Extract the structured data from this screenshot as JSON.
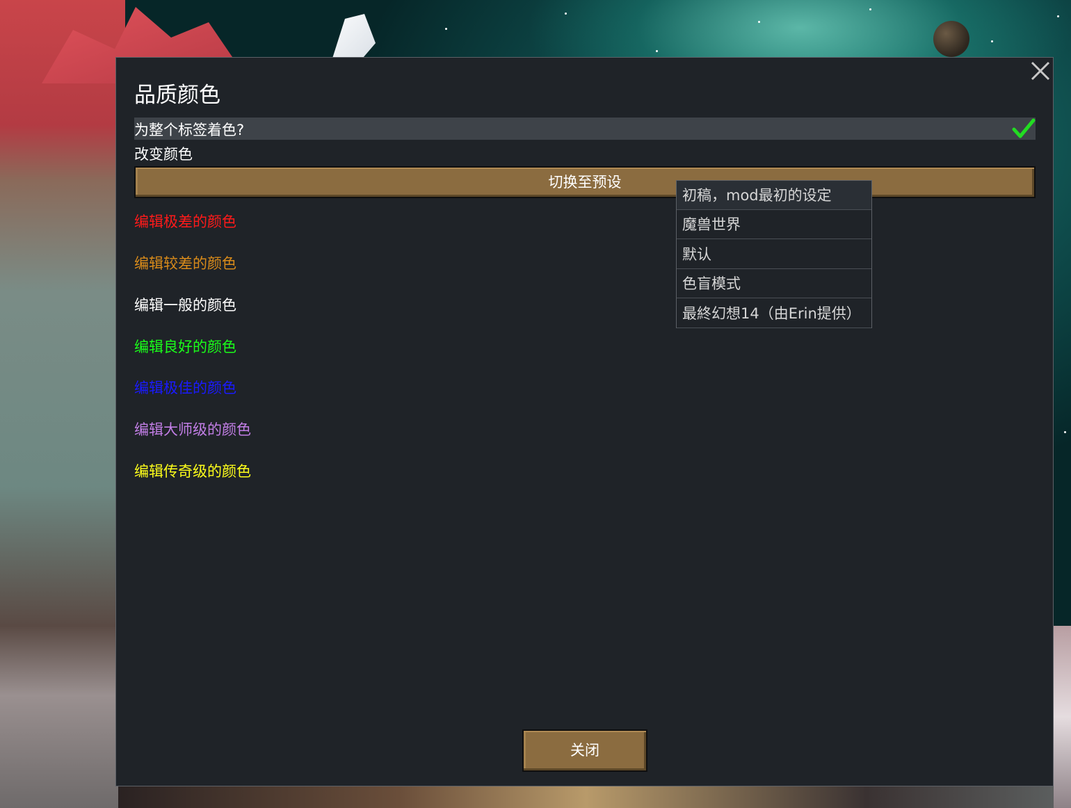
{
  "dialog": {
    "title": "品质颜色",
    "colorize_whole_label": "为整个标签着色?",
    "colorize_whole_checked": true,
    "change_color_label": "改变颜色",
    "preset_button_label": "切换至预设",
    "close_button_label": "关闭"
  },
  "quality_items": [
    {
      "label": "编辑极差的颜色",
      "color": "#ff1a1a"
    },
    {
      "label": "编辑较差的颜色",
      "color": "#d98b1a"
    },
    {
      "label": "编辑一般的颜色",
      "color": "#ffffff"
    },
    {
      "label": "编辑良好的颜色",
      "color": "#1aff1a"
    },
    {
      "label": "编辑极佳的颜色",
      "color": "#1a1aff"
    },
    {
      "label": "编辑大师级的颜色",
      "color": "#c27ee6"
    },
    {
      "label": "编辑传奇级的颜色",
      "color": "#ffff1a"
    }
  ],
  "preset_menu": {
    "options": [
      "初稿，mod最初的设定",
      "魔兽世界",
      "默认",
      "色盲模式",
      "最終幻想14（由Erin提供）"
    ]
  },
  "colors": {
    "panel_bg": "#1f2328",
    "button_bg": "#8b6c40",
    "checkmark": "#22dd22"
  }
}
